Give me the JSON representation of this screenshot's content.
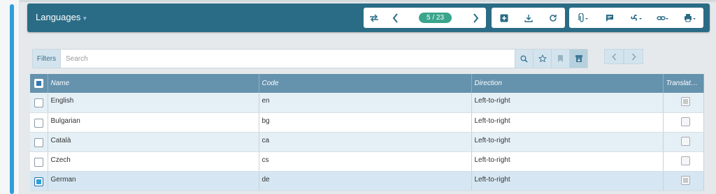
{
  "page": {
    "title": "Languages"
  },
  "toolbar": {
    "pager_label": "5 / 23",
    "icons": [
      "swap-icon",
      "prev-record-icon",
      "next-record-icon",
      "add-icon",
      "download-icon",
      "refresh-icon",
      "attachment-icon",
      "comment-icon",
      "fan-icon",
      "link-icon",
      "print-icon"
    ]
  },
  "search": {
    "filters_label": "Filters",
    "placeholder": "Search"
  },
  "table": {
    "columns": [
      "Name",
      "Code",
      "Direction",
      "Translat…"
    ],
    "rows": [
      {
        "name": "English",
        "code": "en",
        "direction": "Left-to-right",
        "selected": false,
        "translatable": true
      },
      {
        "name": "Bulgarian",
        "code": "bg",
        "direction": "Left-to-right",
        "selected": false,
        "translatable": false
      },
      {
        "name": "Català",
        "code": "ca",
        "direction": "Left-to-right",
        "selected": false,
        "translatable": false
      },
      {
        "name": "Czech",
        "code": "cs",
        "direction": "Left-to-right",
        "selected": false,
        "translatable": false
      },
      {
        "name": "German",
        "code": "de",
        "direction": "Left-to-right",
        "selected": true,
        "translatable": true
      }
    ]
  },
  "colors": {
    "header_bg": "#2a6c86",
    "pager_badge": "#3aa58c",
    "table_header": "#6592ad",
    "accent": "#2f9fd9"
  }
}
